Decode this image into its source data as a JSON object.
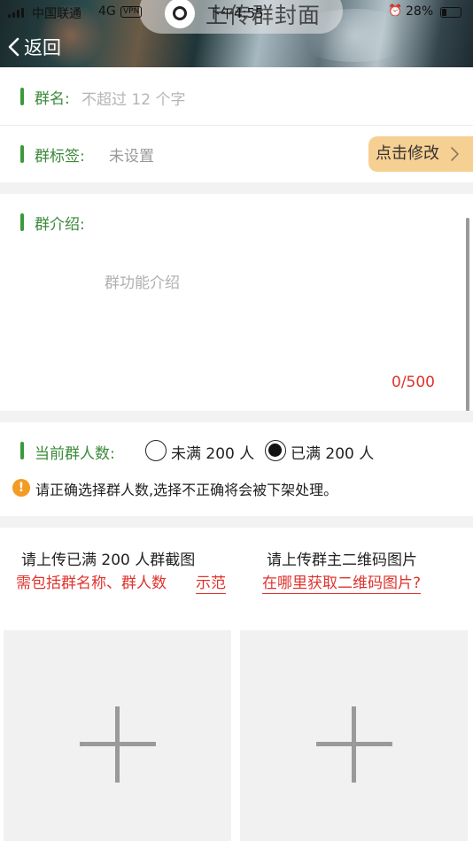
{
  "status_bar": {
    "carrier": "中国联通",
    "network": "4G",
    "vpn": "VPN",
    "time": "下午4:55",
    "battery": "28%"
  },
  "header": {
    "upload_title": "上传群封面",
    "back_label": "返回"
  },
  "form": {
    "name": {
      "label": "群名:",
      "placeholder": "不超过 12 个字"
    },
    "tag": {
      "label": "群标签:",
      "value": "未设置",
      "edit_button": "点击修改"
    },
    "intro": {
      "label": "群介绍:",
      "placeholder": "群功能介绍",
      "counter": "0/500"
    },
    "member_count": {
      "label": "当前群人数:",
      "options": [
        {
          "label": "未满 200 人",
          "selected": false
        },
        {
          "label": "已满 200 人",
          "selected": true
        }
      ],
      "warning": "请正确选择群人数,选择不正确将会被下架处理。"
    },
    "uploads": {
      "left": {
        "title": "请上传已满 200 人群截图",
        "note": "需包括群名称、群人数",
        "link": "示范"
      },
      "right": {
        "title": "请上传群主二维码图片",
        "link": "在哪里获取二维码图片?"
      }
    }
  },
  "colors": {
    "accent_green": "#3c9a3b",
    "warning_red": "#e0332d",
    "edit_button_bg": "#f6cf92",
    "warning_icon": "#f29b25"
  }
}
